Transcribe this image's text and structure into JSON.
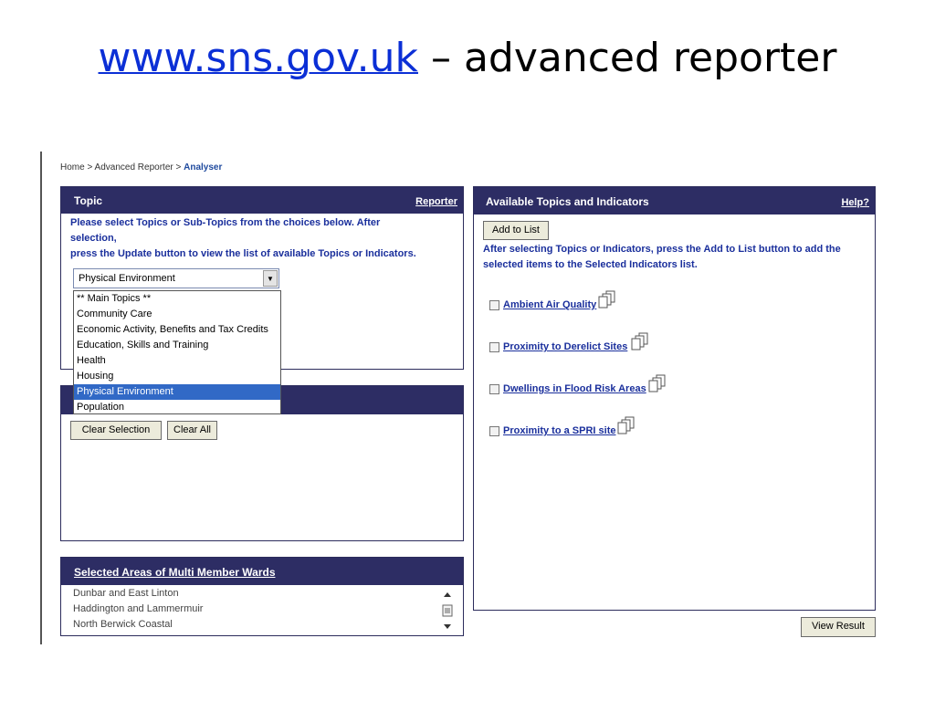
{
  "slide": {
    "title_link": "www.sns.gov.uk",
    "title_rest": " – advanced reporter"
  },
  "breadcrumb": {
    "home": "Home",
    "sep": " > ",
    "advanced": "Advanced Reporter",
    "current": "Analyser"
  },
  "topic_panel": {
    "title": "Topic",
    "link": "Reporter",
    "instructions_1": "Please select Topics or Sub-Topics from the choices below. After",
    "instructions_2": "selection,",
    "instructions_3": "press the Update button to view the list of available Topics or Indicators.",
    "select_value": "Physical Environment",
    "options": [
      "** Main Topics **",
      "Community Care",
      "Economic Activity, Benefits and Tax Credits",
      "Education, Skills and Training",
      "Health",
      "Housing",
      "Physical Environment",
      "Population"
    ],
    "selected_option": "Physical Environment"
  },
  "selection_panel": {
    "clear_selection": "Clear Selection",
    "clear_all": "Clear All"
  },
  "areas_panel": {
    "title": "Selected Areas of Multi Member Wards",
    "items": [
      "Dunbar and East Linton",
      "Haddington and Lammermuir",
      "North Berwick Coastal"
    ]
  },
  "indicators_panel": {
    "title": "Available Topics and Indicators",
    "link": "Help?",
    "add_button": "Add to List",
    "instructions_1": "After selecting Topics or Indicators, press the Add to List button to add the",
    "instructions_2": "selected items to the Selected Indicators list.",
    "items": [
      "Ambient Air Quality",
      "Proximity to Derelict Sites",
      "Dwellings in Flood Risk Areas",
      "Proximity to a SPRI site"
    ]
  },
  "view_result": "View Result",
  "colors": {
    "panel_header": "#2d2d64",
    "link_blue": "#1a2f9c",
    "title_link": "#0b2fd6",
    "selected_option": "#3169c6"
  }
}
